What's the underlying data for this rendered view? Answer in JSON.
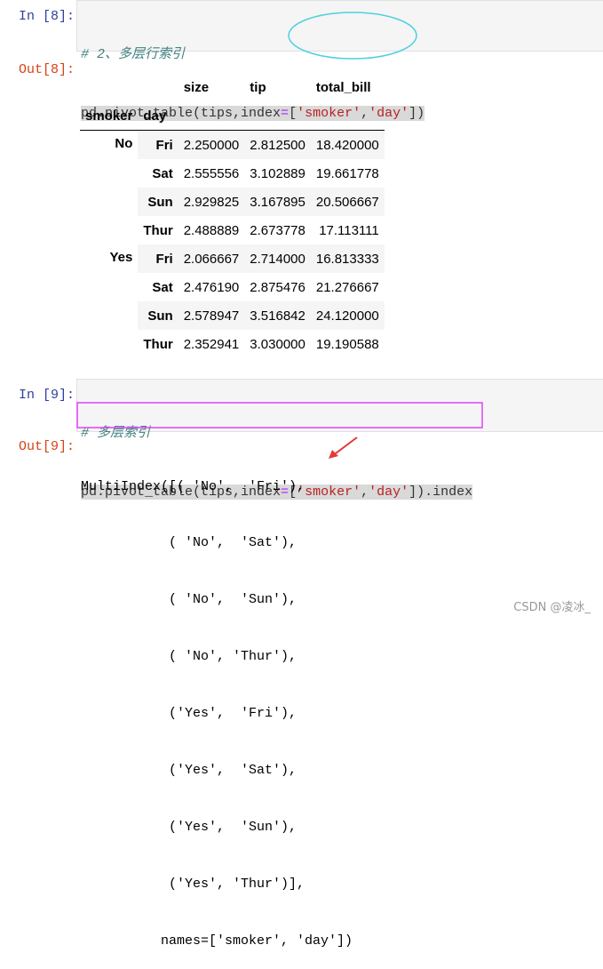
{
  "cell8": {
    "in_prompt": "In  [8]:",
    "comment": "# 2、多层行索引",
    "code": {
      "prefix": "pd.pivot_table(tips,index",
      "eq": "=",
      "lb": "[",
      "s1": "'smoker'",
      "comma": ",",
      "s2": "'day'",
      "rb": "]",
      "suffix": ")"
    },
    "out_prompt": "Out[8]:",
    "table": {
      "columns": [
        "size",
        "tip",
        "total_bill"
      ],
      "index_names": [
        "smoker",
        "day"
      ],
      "groups": [
        {
          "smoker": "No",
          "rows": [
            {
              "day": "Fri",
              "values": [
                "2.250000",
                "2.812500",
                "18.420000"
              ]
            },
            {
              "day": "Sat",
              "values": [
                "2.555556",
                "3.102889",
                "19.661778"
              ]
            },
            {
              "day": "Sun",
              "values": [
                "2.929825",
                "3.167895",
                "20.506667"
              ]
            },
            {
              "day": "Thur",
              "values": [
                "2.488889",
                "2.673778",
                "17.113111"
              ]
            }
          ]
        },
        {
          "smoker": "Yes",
          "rows": [
            {
              "day": "Fri",
              "values": [
                "2.066667",
                "2.714000",
                "16.813333"
              ]
            },
            {
              "day": "Sat",
              "values": [
                "2.476190",
                "2.875476",
                "21.276667"
              ]
            },
            {
              "day": "Sun",
              "values": [
                "2.578947",
                "3.516842",
                "24.120000"
              ]
            },
            {
              "day": "Thur",
              "values": [
                "2.352941",
                "3.030000",
                "19.190588"
              ]
            }
          ]
        }
      ]
    }
  },
  "cell9": {
    "in_prompt": "In  [9]:",
    "comment": "# 多层索引",
    "code": {
      "prefix": "pd.pivot_table(tips,index",
      "eq": "=",
      "lb": "[",
      "s1": "'smoker'",
      "comma": ",",
      "s2": "'day'",
      "rb": "]",
      "suffix": ").index"
    },
    "out_prompt": "Out[9]:",
    "output_lines": [
      "MultiIndex([( 'No',  'Fri'),",
      "           ( 'No',  'Sat'),",
      "           ( 'No',  'Sun'),",
      "           ( 'No', 'Thur'),",
      "           ('Yes',  'Fri'),",
      "           ('Yes',  'Sat'),",
      "           ('Yes',  'Sun'),",
      "           ('Yes', 'Thur')],",
      "          names=['smoker', 'day'])"
    ]
  },
  "annotations": {
    "ellipse_color": "#4dd0e1",
    "box_color": "#e040fb",
    "arrow_color": "#e53935"
  },
  "watermark": "CSDN @凌冰_"
}
